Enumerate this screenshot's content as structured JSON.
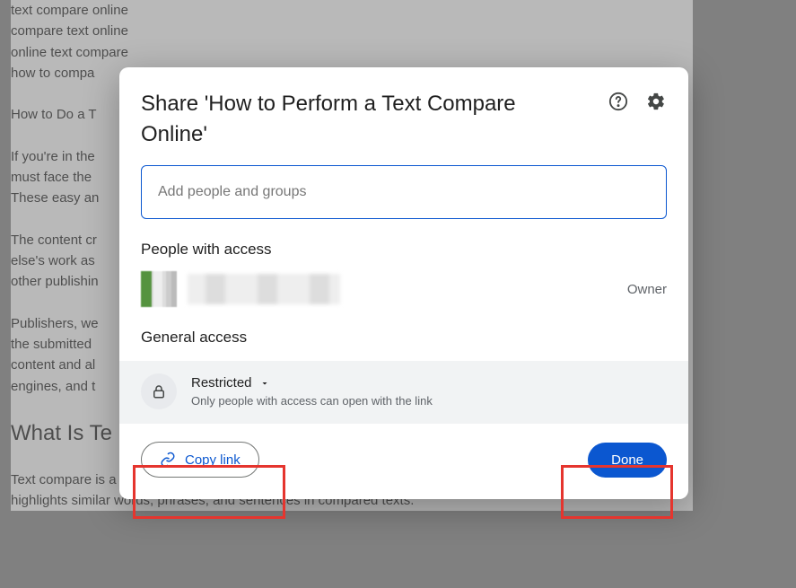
{
  "doc": {
    "lines": [
      "text compare online",
      "compare text online",
      "online text compare",
      "how to compa",
      "",
      "How to Do a T",
      "",
      "If you're in the",
      "must face the",
      "These easy an",
      "",
      "The content cr",
      "else's work as",
      "other publishin",
      "",
      "Publishers, we",
      "the submitted",
      "content and al",
      "engines, and t"
    ],
    "heading": "What Is Te",
    "paragraph": "Text compare is a process of using a software program to visualize texts side by side. The program code also highlights similar words, phrases, and sentences in compared texts."
  },
  "dialog": {
    "title": "Share 'How to Perform a Text Compare Online'",
    "add_placeholder": "Add people and groups",
    "people_section": "People with access",
    "owner_role": "Owner",
    "general_section": "General access",
    "access_mode": "Restricted",
    "access_desc": "Only people with access can open with the link",
    "copy_link": "Copy link",
    "done": "Done"
  }
}
